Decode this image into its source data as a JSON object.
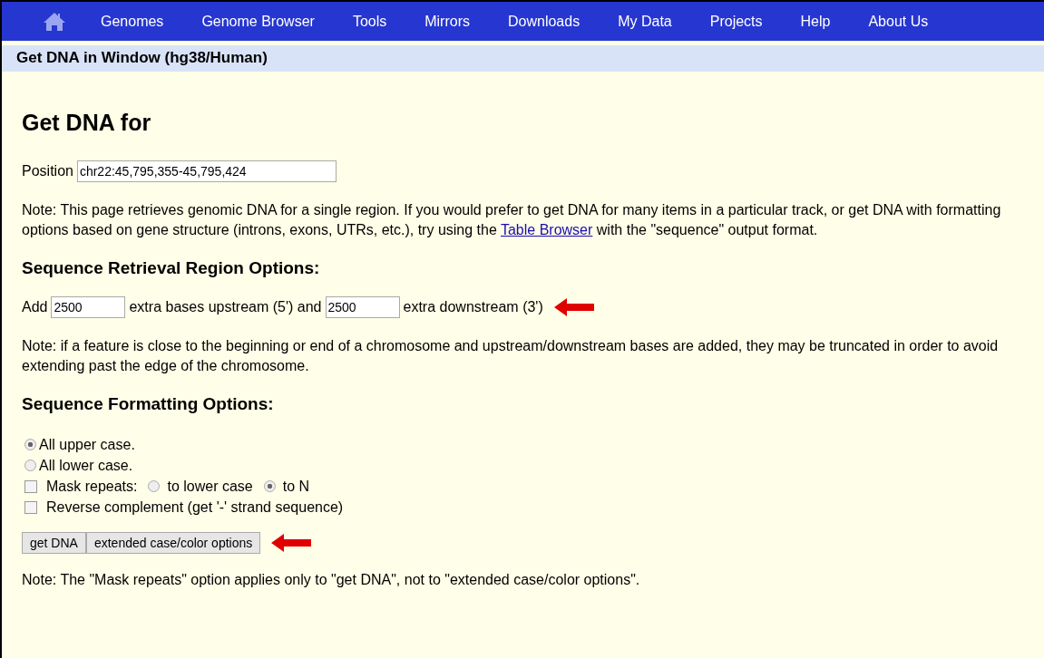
{
  "nav": {
    "items": [
      "Genomes",
      "Genome Browser",
      "Tools",
      "Mirrors",
      "Downloads",
      "My Data",
      "Projects",
      "Help",
      "About Us"
    ]
  },
  "title_bar": "Get DNA in Window (hg38/Human)",
  "heading": "Get DNA for",
  "position": {
    "label": "Position",
    "value": "chr22:45,795,355-45,795,424"
  },
  "note": {
    "before": "Note: This page retrieves genomic DNA for a single region. If you would prefer to get DNA for many items in a particular track, or get DNA with formatting options based on gene structure (introns, exons, UTRs, etc.), try using the ",
    "link": "Table Browser",
    "after": " with the \"sequence\" output format."
  },
  "region_heading": "Sequence Retrieval Region Options:",
  "region": {
    "add_label": "Add",
    "upstream": "2500",
    "middle": "extra bases upstream (5') and",
    "downstream": "2500",
    "end": "extra downstream (3')"
  },
  "region_note": "Note: if a feature is close to the beginning or end of a chromosome and upstream/downstream bases are added, they may be truncated in order to avoid extending past the edge of the chromosome.",
  "format_heading": "Sequence Formatting Options:",
  "format_options": [
    {
      "kind": "radio",
      "label": "All upper case.",
      "selected": true
    },
    {
      "kind": "radio",
      "label": "All lower case.",
      "selected": false
    },
    {
      "kind": "checkbox",
      "label": "Mask repeats:",
      "checked": false,
      "choices": [
        {
          "label": "to lower case",
          "selected": false
        },
        {
          "label": "to N",
          "selected": true
        }
      ]
    },
    {
      "kind": "checkbox",
      "label": "Reverse complement (get '-' strand sequence)",
      "checked": false
    }
  ],
  "buttons": [
    "get DNA",
    "extended case/color options"
  ],
  "bottom_note": "Note: The \"Mask repeats\" option applies only to \"get DNA\", not to \"extended case/color options\"."
}
